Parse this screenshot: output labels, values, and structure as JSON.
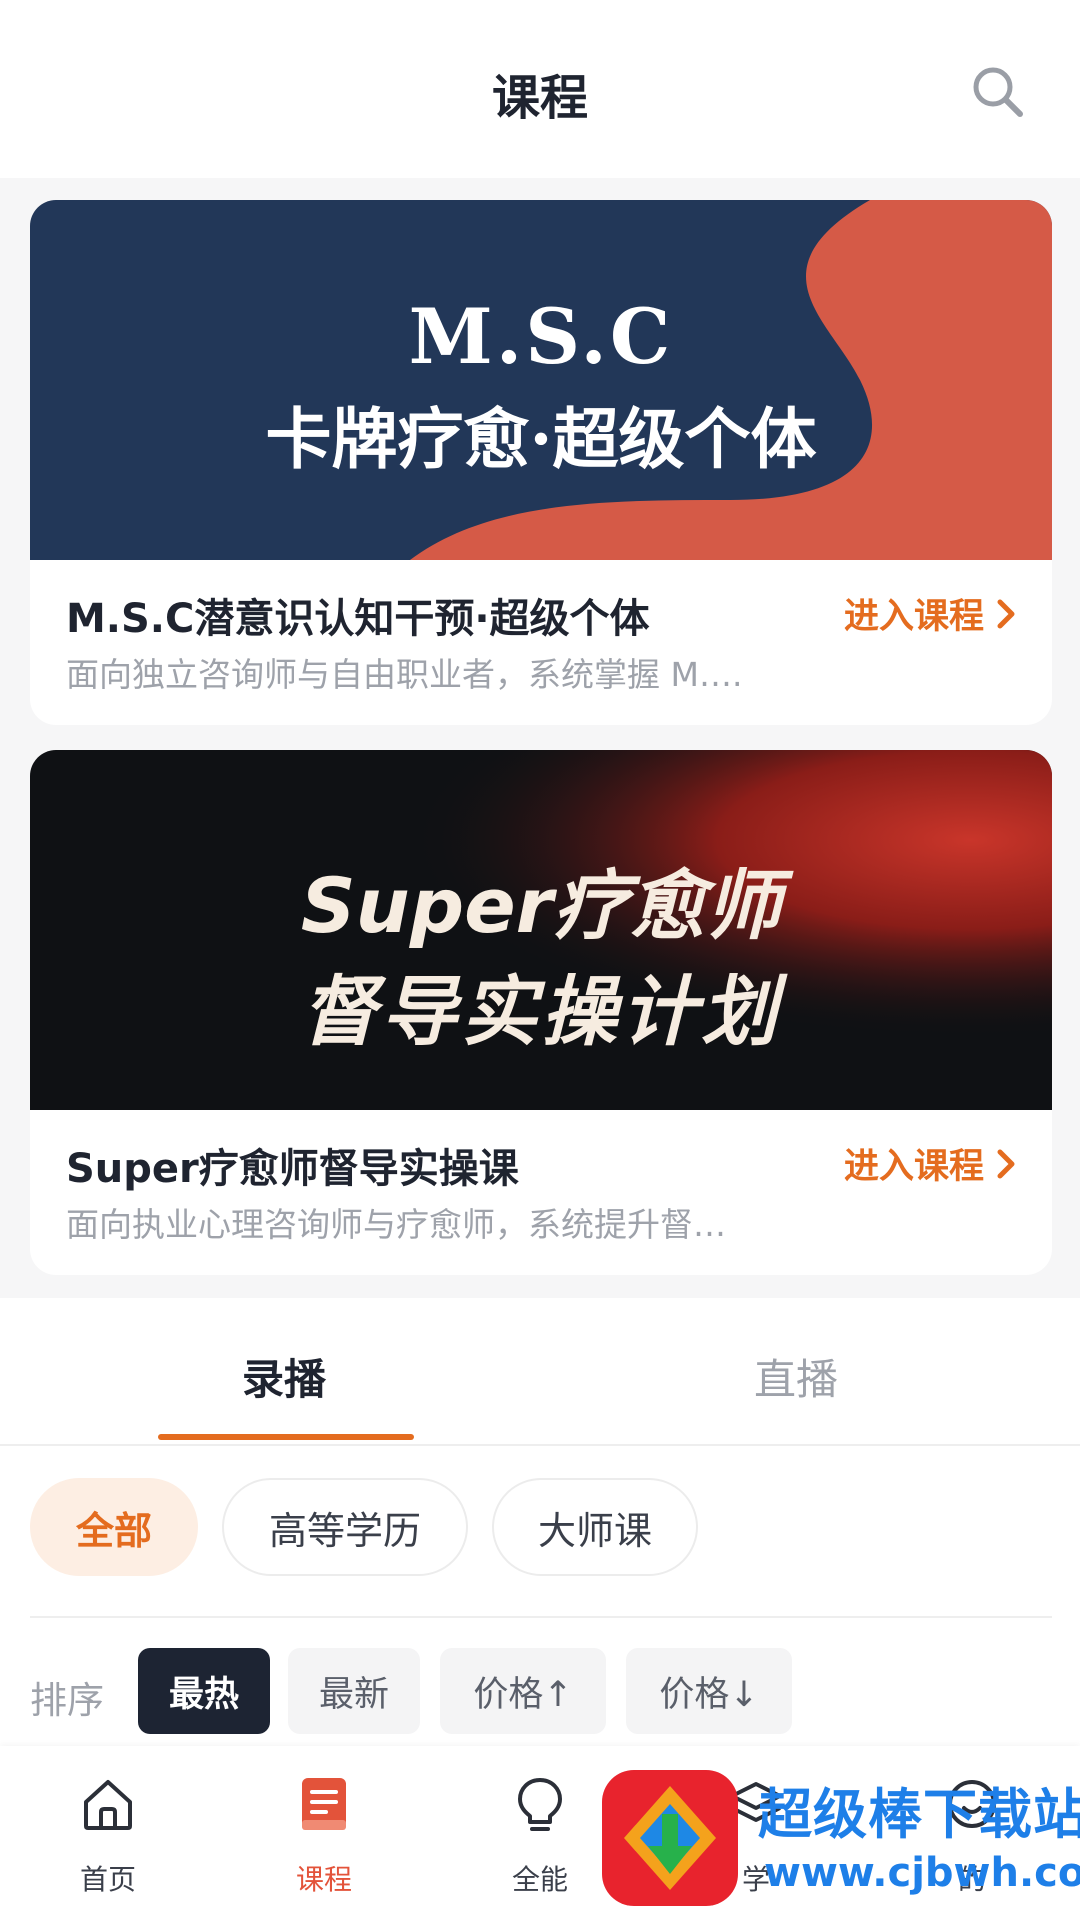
{
  "header": {
    "title": "课程",
    "search_icon": "search-icon"
  },
  "courses": [
    {
      "banner_line1": "M.S.C",
      "banner_line2": "卡牌疗愈·超级个体",
      "title": "M.S.C潜意识认知干预·超级个体",
      "desc": "面向独立咨询师与自由职业者，系统掌握 M….",
      "action": "进入课程",
      "colors": {
        "navy": "#223758",
        "coral": "#d55a47"
      }
    },
    {
      "banner_line1": "Super疗愈师",
      "banner_line2": "督导实操计划",
      "title": "Super疗愈师督导实操课",
      "desc": "面向执业心理咨询师与疗愈师，系统提升督…",
      "action": "进入课程",
      "colors": {
        "dark": "#0f1114",
        "red": "#b02a22"
      }
    }
  ],
  "tabs": [
    {
      "label": "录播",
      "active": true
    },
    {
      "label": "直播",
      "active": false
    }
  ],
  "filters": [
    {
      "label": "全部",
      "active": true
    },
    {
      "label": "高等学历",
      "active": false
    },
    {
      "label": "大师课",
      "active": false
    }
  ],
  "sort": {
    "label": "排序",
    "options": [
      {
        "label": "最热",
        "active": true
      },
      {
        "label": "最新",
        "active": false
      },
      {
        "label": "价格↑",
        "active": false
      },
      {
        "label": "价格↓",
        "active": false
      }
    ]
  },
  "nav": [
    {
      "label": "首页",
      "icon": "home-icon",
      "active": false
    },
    {
      "label": "课程",
      "icon": "course-book-icon",
      "active": true
    },
    {
      "label": "全能",
      "icon": "lightbulb-icon",
      "active": false
    },
    {
      "label": "学",
      "icon": "layers-icon",
      "active": false
    },
    {
      "label": "的",
      "icon": "profile-icon",
      "active": false
    }
  ],
  "watermark": {
    "line1": "超级棒下载站",
    "line2": "www.cjbwh.com"
  },
  "accent_color": "#e46c1f"
}
